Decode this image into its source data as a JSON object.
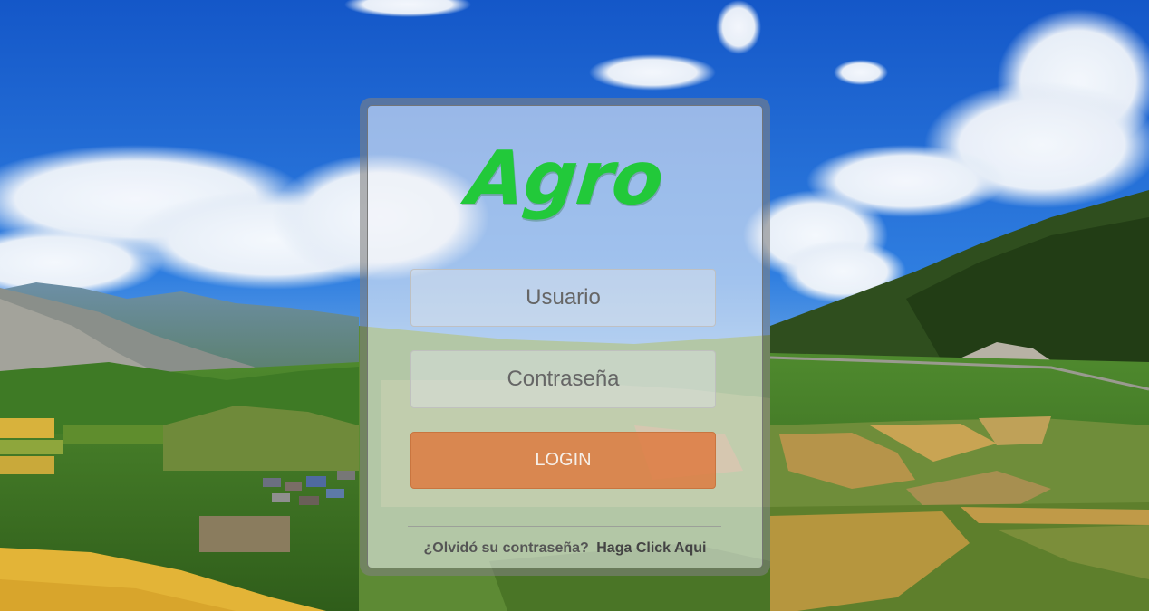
{
  "brand": {
    "name": "Agro",
    "color": "#22c93a"
  },
  "form": {
    "username_placeholder": "Usuario",
    "username_value": "",
    "password_placeholder": "Contraseña",
    "password_value": "",
    "login_label": "LOGIN",
    "login_color": "#de783c"
  },
  "footer": {
    "forgot_text": "¿Olvidó su contraseña?",
    "link_text": "Haga Click Aqui"
  },
  "background": {
    "description_icon": "landscape-image",
    "sky_color": "#1f64cf",
    "field_color": "#e3b437"
  }
}
